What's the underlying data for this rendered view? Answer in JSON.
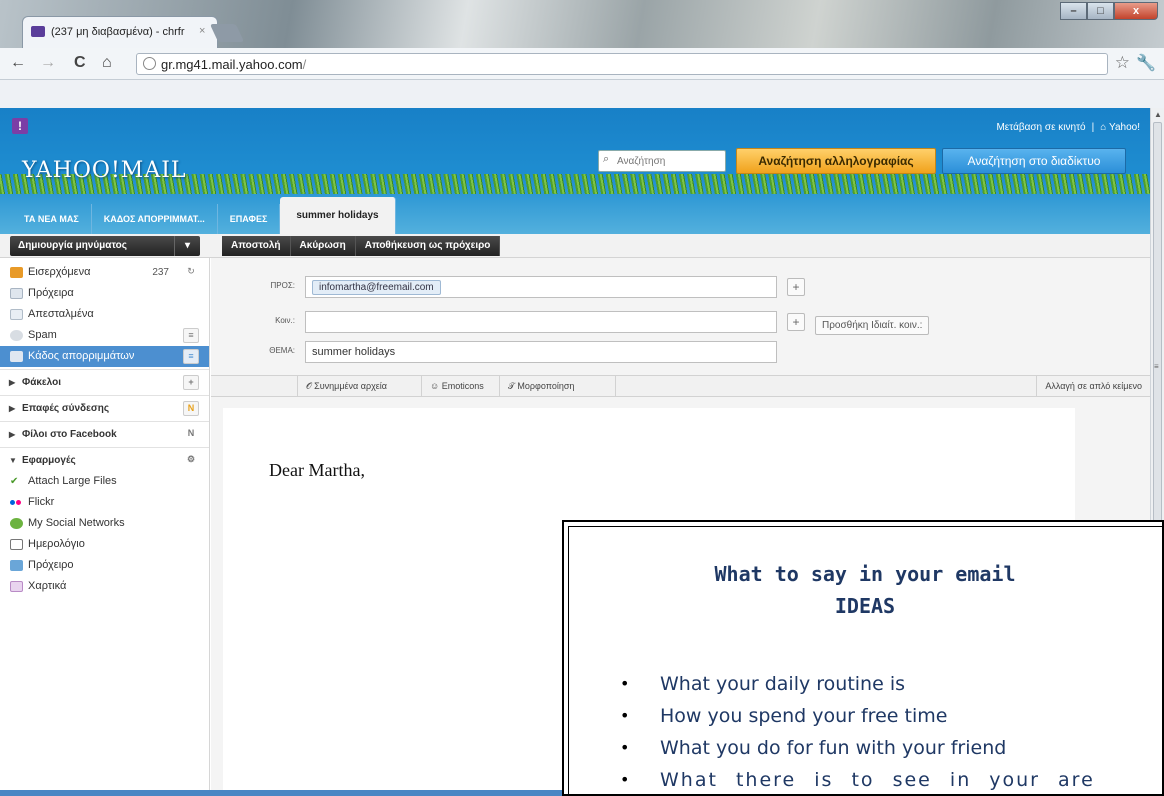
{
  "browser": {
    "tab_title": "(237 μη διαβασμένα) - chrfr",
    "tab_close": "×",
    "url_host": "gr.mg41.mail.yahoo.com",
    "url_path": "/",
    "back": "←",
    "forward": "→",
    "reload": "C",
    "home": "⌂",
    "star": "☆",
    "wrench": "🔧",
    "win_min": "–",
    "win_max": "□",
    "win_close": "x"
  },
  "header": {
    "logo": "YAHOO!MAIL",
    "mobile_link": "Μετάβαση σε κινητό",
    "link_sep": "|",
    "home_link": "Yahoo!",
    "search_placeholder": "Αναζήτηση",
    "search_mail_btn": "Αναζήτηση αλληλογραφίας",
    "search_web_btn": "Αναζήτηση στο διαδίκτυο",
    "tabs": [
      {
        "label": "ΤΑ ΝΕΑ ΜΑΣ"
      },
      {
        "label": "ΚΑΔΟΣ ΑΠΟΡΡΙΜΜΑΤ..."
      },
      {
        "label": "ΕΠΑΦΕΣ"
      },
      {
        "label": "summer holidays"
      }
    ]
  },
  "actions": {
    "compose": "Δημιουργία μηνύματος",
    "compose_dd": "▾",
    "send": "Αποστολή",
    "cancel": "Ακύρωση",
    "save_draft": "Αποθήκευση ως πρόχειρο"
  },
  "sidebar": {
    "items": [
      {
        "label": "Εισερχόμενα",
        "count": "237",
        "btn": "↻"
      },
      {
        "label": "Πρόχειρα"
      },
      {
        "label": "Απεσταλμένα"
      },
      {
        "label": "Spam",
        "btn": "≡"
      },
      {
        "label": "Κάδος απορριμμάτων",
        "btn": "≡"
      }
    ],
    "folders": [
      {
        "label": "Φάκελοι",
        "btn": "+"
      },
      {
        "label": "Επαφές σύνδεσης",
        "btn": "N"
      },
      {
        "label": "Φίλοι στο Facebook",
        "btn": "N"
      },
      {
        "label": "Εφαρμογές",
        "btn": "⚙"
      }
    ],
    "apps": [
      {
        "label": "Attach Large Files"
      },
      {
        "label": "Flickr"
      },
      {
        "label": "My Social Networks"
      },
      {
        "label": "Ημερολόγιο"
      },
      {
        "label": "Πρόχειρο"
      },
      {
        "label": "Χαρτικά"
      }
    ],
    "tri_closed": "▶",
    "tri_open": "▼"
  },
  "compose": {
    "to_label": "ΠΡΟΣ:",
    "to_value": "infomartha@freemail.com",
    "cc_label": "Κοιν.:",
    "subject_label": "ΘΕΜΑ:",
    "subject_value": "summer holidays",
    "plus": "+",
    "bcc_btn": "Προσθήκη Ιδιαίτ. κοιν.:",
    "attachments": "Συνημμένα αρχεία",
    "emoticons": "Emoticons",
    "formatting": "Μορφοποίηση",
    "plain_text": "Αλλαγή σε απλό κείμενο",
    "greeting": "Dear Martha,"
  },
  "ideas": {
    "title_1": "What to say in your email",
    "title_2": "IDEAS",
    "bullet": "•",
    "items": [
      "What your daily routine is",
      "How you spend your free time",
      "What you do for fun with your friend",
      "What there is to see in your are"
    ]
  },
  "colors": {
    "yahoo_blue": "#1f8ed1",
    "mail_btn": "#f0a21c",
    "ideas_text": "#1f3864"
  }
}
